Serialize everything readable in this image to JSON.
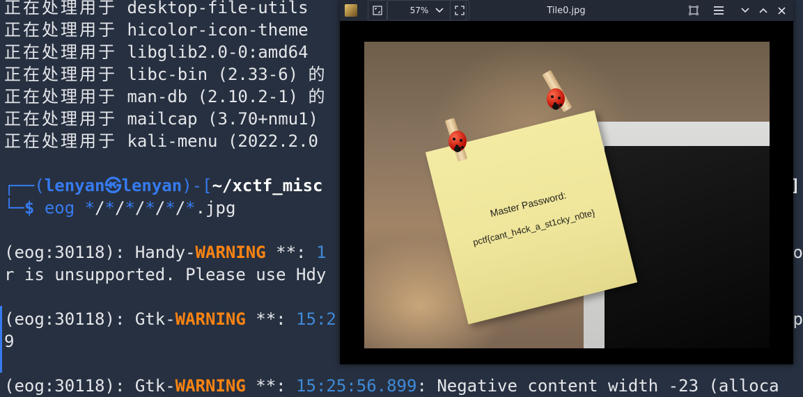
{
  "terminal": {
    "processing_prefix": "正在处理用于",
    "processing_lines": [
      "desktop-file-utils",
      "hicolor-icon-theme",
      "libglib2.0-0:amd64",
      "libc-bin (2.33-6) 的",
      "man-db (2.10.2-1) 的",
      "mailcap (3.70+nmu1)",
      "kali-menu (2022.2.0"
    ],
    "prompt": {
      "box_top": "┌──(",
      "user": "lenyan",
      "at_symbol": "㉿",
      "host": "lenyan",
      "bracket_mid": ")-[",
      "path": "~/xctf_misc",
      "tail_right": "e]",
      "box_bottom": "└─",
      "dollar": "$",
      "command": "eog",
      "glob_star": "*",
      "glob_slash": "/",
      "glob_ext": ".jpg"
    },
    "log": {
      "pid_prefix": "(eog:30118): ",
      "handy": "Handy-",
      "gtk": "Gtk-",
      "warning": "WARNING",
      "stars": " **: ",
      "line1_time_fragment": "1",
      "line1_right_fragment": "io",
      "line2_text": "r is unsupported. Please use Hdy",
      "line3_time_fragment": "15:2",
      "line3_right_fragment": "mp",
      "line4_text": "9",
      "line5_time": "15:25:56.899",
      "line5_rest": ": Negative content width -23 (alloca"
    }
  },
  "viewer": {
    "title": "Tile0.jpg",
    "zoom": "57%",
    "note_line1": "Master Password:",
    "note_line2": "pctf{cant_h4ck_a_st1cky_n0te}"
  }
}
